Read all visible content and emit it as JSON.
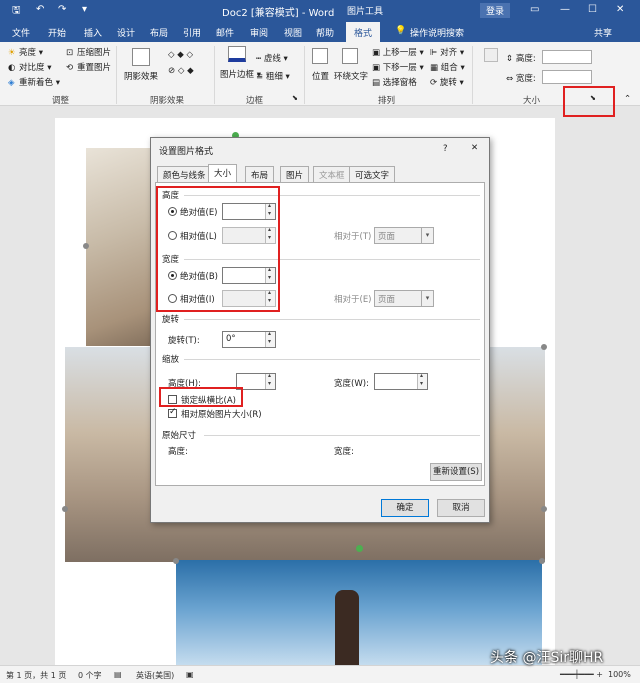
{
  "titlebar": {
    "doc_title": "Doc2 [兼容模式] - Word",
    "tools_label": "图片工具",
    "login": "登录"
  },
  "tabs": [
    "文件",
    "开始",
    "插入",
    "设计",
    "布局",
    "引用",
    "邮件",
    "审阅",
    "视图",
    "帮助",
    "格式",
    "操作说明搜索",
    "共享"
  ],
  "ribbon": {
    "adjust": {
      "brightness": "亮度",
      "contrast": "对比度",
      "recolor": "重新着色",
      "compress": "压缩图片",
      "reset": "重置图片",
      "label": "调整"
    },
    "effects": {
      "shadow": "阴影效果",
      "label": "阴影效果"
    },
    "border": {
      "picture_border": "图片边框",
      "dashes": "虚线",
      "weight": "粗细",
      "label": "边框"
    },
    "arrange": {
      "position": "位置",
      "wrap": "环绕文字",
      "forward": "上移一层",
      "backward": "下移一层",
      "pane": "选择窗格",
      "align": "对齐",
      "group": "组合",
      "rotate": "旋转",
      "label": "排列"
    },
    "size": {
      "height": "高度:",
      "width": "宽度:",
      "label": "大小"
    }
  },
  "dialog": {
    "title": "设置图片格式",
    "help": "?",
    "close": "✕",
    "tabs": [
      "颜色与线条",
      "大小",
      "布局",
      "图片",
      "文本框",
      "可选文字"
    ],
    "height": {
      "title": "高度",
      "absolute": "绝对值(E)",
      "relative": "相对值(L)",
      "relative_to": "相对于(T)",
      "relative_to_value": "页面"
    },
    "width": {
      "title": "宽度",
      "absolute": "绝对值(B)",
      "relative": "相对值(I)",
      "relative_to": "相对于(E)",
      "relative_to_value": "页面"
    },
    "rotation": {
      "title": "旋转",
      "label": "旋转(T):",
      "value": "0°"
    },
    "scale": {
      "title": "缩放",
      "height": "高度(H):",
      "width": "宽度(W):",
      "lock_aspect": "锁定纵横比(A)",
      "relative_original": "相对原始图片大小(R)"
    },
    "original": {
      "title": "原始尺寸",
      "height": "高度:",
      "width": "宽度:",
      "reset": "重新设置(S)"
    },
    "ok": "确定",
    "cancel": "取消"
  },
  "status": {
    "page": "第 1 页，共 1 页",
    "words": "0 个字",
    "lang": "英语(美国)",
    "zoom": "100%"
  },
  "watermark": "头条 @汪Sir聊HR"
}
